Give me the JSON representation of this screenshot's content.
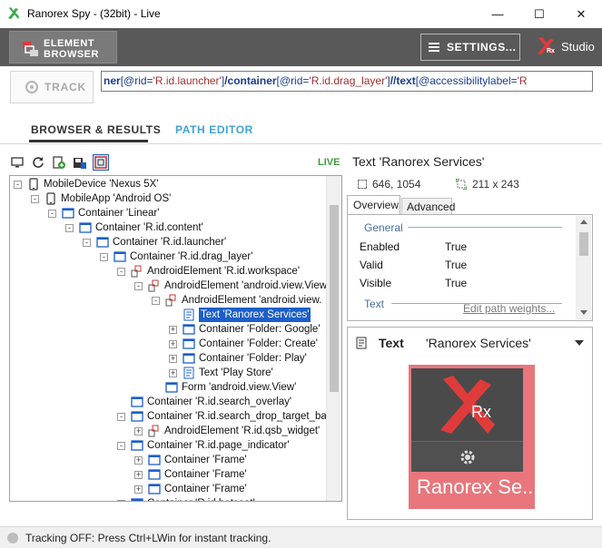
{
  "window": {
    "title": "Ranorex Spy - (32bit) - Live",
    "controls": {
      "minimize": "—",
      "maximize": "☐",
      "close": "✕"
    }
  },
  "toolbar": {
    "element_browser_line1": "ELEMENT",
    "element_browser_line2": "BROWSER",
    "settings_label": "SETTINGS...",
    "studio_label": "Studio",
    "logo_text": "Rx"
  },
  "track": {
    "label": "TRACK",
    "path_tokens": [
      {
        "t": "tag",
        "v": "ner"
      },
      {
        "t": "attr",
        "v": "[@rid="
      },
      {
        "t": "str",
        "v": "'R.id.launcher'"
      },
      {
        "t": "attr",
        "v": "]"
      },
      {
        "t": "sep",
        "v": "/"
      },
      {
        "t": "tag",
        "v": "container"
      },
      {
        "t": "attr",
        "v": "[@rid="
      },
      {
        "t": "str",
        "v": "'R.id.drag_layer'"
      },
      {
        "t": "attr",
        "v": "]"
      },
      {
        "t": "sep",
        "v": "//"
      },
      {
        "t": "tag",
        "v": "text"
      },
      {
        "t": "attr",
        "v": "[@accessibilitylabel="
      },
      {
        "t": "str",
        "v": "'R"
      }
    ]
  },
  "tabs": {
    "browser": "BROWSER & RESULTS",
    "path_editor": "PATH EDITOR"
  },
  "tree": {
    "live_label": "LIVE",
    "items": [
      {
        "label": "MobileDevice 'Nexus 5X'",
        "level": 0,
        "expander": "-",
        "icon": "device"
      },
      {
        "label": "MobileApp 'Android OS'",
        "level": 1,
        "expander": "-",
        "icon": "device"
      },
      {
        "label": "Container 'Linear'",
        "level": 2,
        "expander": "-",
        "icon": "container"
      },
      {
        "label": "Container 'R.id.content'",
        "level": 3,
        "expander": "-",
        "icon": "container"
      },
      {
        "label": "Container 'R.id.launcher'",
        "level": 4,
        "expander": "-",
        "icon": "container"
      },
      {
        "label": "Container 'R.id.drag_layer'",
        "level": 5,
        "expander": "-",
        "icon": "container"
      },
      {
        "label": "AndroidElement 'R.id.workspace'",
        "level": 6,
        "expander": "-",
        "icon": "android"
      },
      {
        "label": "AndroidElement 'android.view.View",
        "level": 7,
        "expander": "-",
        "icon": "android"
      },
      {
        "label": "AndroidElement 'android.view.",
        "level": 8,
        "expander": "-",
        "icon": "android"
      },
      {
        "label": "Text 'Ranorex Services'",
        "level": 9,
        "expander": "",
        "icon": "text",
        "selected": true
      },
      {
        "label": "Container 'Folder: Google'",
        "level": 9,
        "expander": "+",
        "icon": "container"
      },
      {
        "label": "Container 'Folder: Create'",
        "level": 9,
        "expander": "+",
        "icon": "container"
      },
      {
        "label": "Container 'Folder: Play'",
        "level": 9,
        "expander": "+",
        "icon": "container"
      },
      {
        "label": "Text 'Play Store'",
        "level": 9,
        "expander": "+",
        "icon": "text"
      },
      {
        "label": "Form 'android.view.View'",
        "level": 8,
        "expander": "",
        "icon": "container"
      },
      {
        "label": "Container 'R.id.search_overlay'",
        "level": 6,
        "expander": "",
        "icon": "container"
      },
      {
        "label": "Container 'R.id.search_drop_target_ba",
        "level": 6,
        "expander": "-",
        "icon": "container"
      },
      {
        "label": "AndroidElement 'R.id.qsb_widget'",
        "level": 7,
        "expander": "+",
        "icon": "android"
      },
      {
        "label": "Container 'R.id.page_indicator'",
        "level": 6,
        "expander": "-",
        "icon": "container"
      },
      {
        "label": "Container 'Frame'",
        "level": 7,
        "expander": "+",
        "icon": "container"
      },
      {
        "label": "Container 'Frame'",
        "level": 7,
        "expander": "+",
        "icon": "container"
      },
      {
        "label": "Container 'Frame'",
        "level": 7,
        "expander": "+",
        "icon": "container"
      },
      {
        "label": "Container 'R.id.hotseat'",
        "level": 6,
        "expander": "-",
        "icon": "container"
      }
    ]
  },
  "details": {
    "title": "Text 'Ranorex Services'",
    "coords": "646, 1054",
    "size": "211 x 243",
    "tab_overview": "Overview",
    "tab_advanced": "Advanced",
    "section_general": "General",
    "section_text": "Text",
    "props": [
      {
        "key": "Enabled",
        "value": "True"
      },
      {
        "key": "Valid",
        "value": "True"
      },
      {
        "key": "Visible",
        "value": "True"
      }
    ],
    "edit_path_link": "Edit path weights..."
  },
  "preview": {
    "type_label": "Text",
    "value_label": "'Ranorex Services'",
    "image_caption": "Ranorex Se..",
    "image_logo": "Rx"
  },
  "status": {
    "text": "Tracking OFF: Press Ctrl+LWin for instant tracking."
  }
}
